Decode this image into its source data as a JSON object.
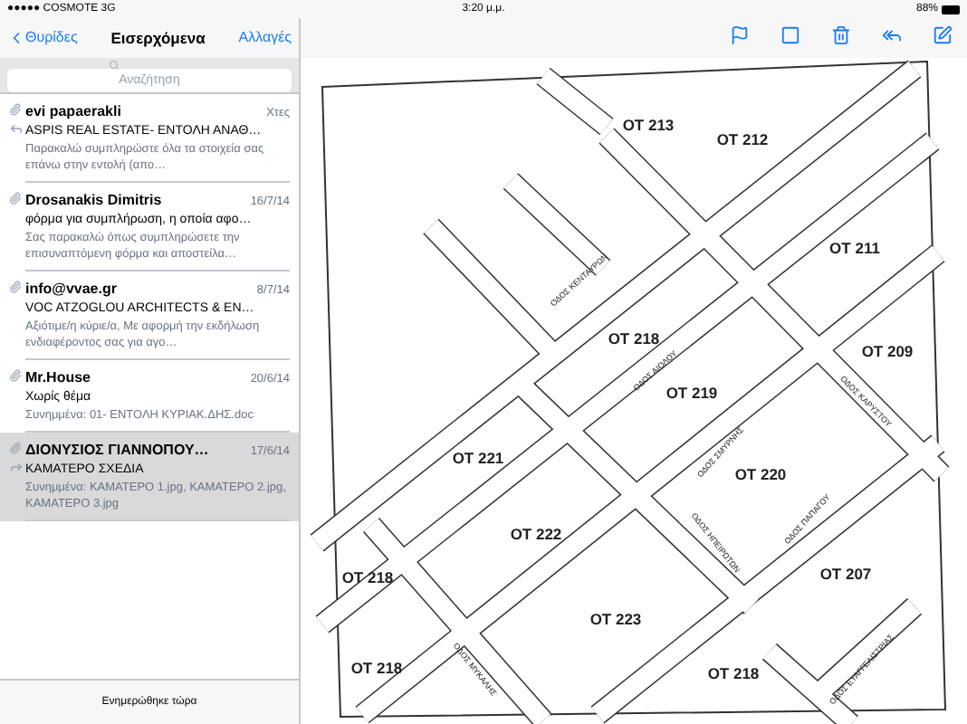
{
  "status_bar": {
    "carrier": "●●●●● COSMOTE 3G",
    "time": "3:20 μ.μ.",
    "battery": "88%"
  },
  "mailbox": {
    "back_label": "Θυρίδες",
    "title": "Εισερχόμενα",
    "edit_label": "Αλλαγές",
    "search": {
      "placeholder": "Αναζήτηση"
    },
    "messages": [
      {
        "sender": "evi papaerakli",
        "date": "Χτες",
        "subject": "ASPIS REAL ESTATE- ΕΝΤΟΛΗ ΑΝΑΘ…",
        "preview": "Παρακαλώ συμπληρώστε όλα τα στοιχεία σας επάνω στην εντολή (απο…",
        "has_attachment": true,
        "replied": true,
        "forwarded": false,
        "selected": false
      },
      {
        "sender": "Drosanakis Dimitris",
        "date": "16/7/14",
        "subject": "φόρμα για συμπλήρωση, η οποία αφο…",
        "preview": "Σας παρακαλώ όπως συμπληρώσετε την επισυναπτόμενη φόρμα και αποστείλα…",
        "has_attachment": true,
        "replied": false,
        "forwarded": false,
        "selected": false
      },
      {
        "sender": "info@vvae.gr",
        "date": "8/7/14",
        "subject": "VOC ATZOGLOU ARCHITECTS & EN…",
        "preview": "Αξιότιμε/η κύριε/α, Με αφορμή την εκδήλωση ενδιαφέροντος σας για αγο…",
        "has_attachment": true,
        "replied": false,
        "forwarded": false,
        "selected": false
      },
      {
        "sender": "Mr.House",
        "date": "20/6/14",
        "subject": "Χωρίς θέμα",
        "preview": "Συνημμένα: 01- ΕΝΤΟΛΗ ΚΥΡΙΑΚ.ΔΗΣ.doc",
        "has_attachment": true,
        "replied": false,
        "forwarded": false,
        "selected": false
      },
      {
        "sender": "ΔΙΟΝΥΣΙΟΣ ΓΙΑΝΝΟΠΟΥ…",
        "date": "17/6/14",
        "subject": "ΚΑΜΑΤΕΡΟ ΣΧΕΔΙΑ",
        "preview": "Συνημμένα: ΚΑΜΑΤΕΡΟ 1.jpg, ΚΑΜΑΤΕΡΟ 2.jpg, ΚΑΜΑΤΕΡΟ 3.jpg",
        "has_attachment": true,
        "replied": false,
        "forwarded": true,
        "selected": true
      }
    ],
    "footer": "Ενημερώθηκε τώρα"
  },
  "map": {
    "blocks": [
      {
        "label": "ΟΤ 213"
      },
      {
        "label": "ΟΤ 212"
      },
      {
        "label": "ΟΤ 211"
      },
      {
        "label": "ΟΤ 218"
      },
      {
        "label": "ΟΤ 209"
      },
      {
        "label": "ΟΤ 219"
      },
      {
        "label": "ΟΤ 221"
      },
      {
        "label": "ΟΤ 220"
      },
      {
        "label": "ΟΤ 222"
      },
      {
        "label": "ΟΤ 218"
      },
      {
        "label": "ΟΤ 207"
      },
      {
        "label": "ΟΤ 223"
      },
      {
        "label": "ΟΤ 218"
      },
      {
        "label": "ΟΤ 218"
      }
    ],
    "streets": [
      {
        "label": "ΟΔΟΣ ΚΕΝΤΑΥΡΩΝ"
      },
      {
        "label": "ΟΔΟΣ ΑΙΟΛΟΥ"
      },
      {
        "label": "ΟΔΟΣ ΚΑΡΥΣΤΟΥ"
      },
      {
        "label": "ΟΔΟΣ ΣΜΥΡΝΗΣ"
      },
      {
        "label": "ΟΔΟΣ ΗΠΕΙΡΩΤΩΝ"
      },
      {
        "label": "ΟΔΟΣ ΠΑΠΑΓΟΥ"
      },
      {
        "label": "ΟΔΟΣ ΜΥΚΑΛΗΣ"
      },
      {
        "label": "ΟΔΟΣ ΕΥΑΓΓΕΛΙΣΤΡΙΑΣ"
      }
    ]
  }
}
